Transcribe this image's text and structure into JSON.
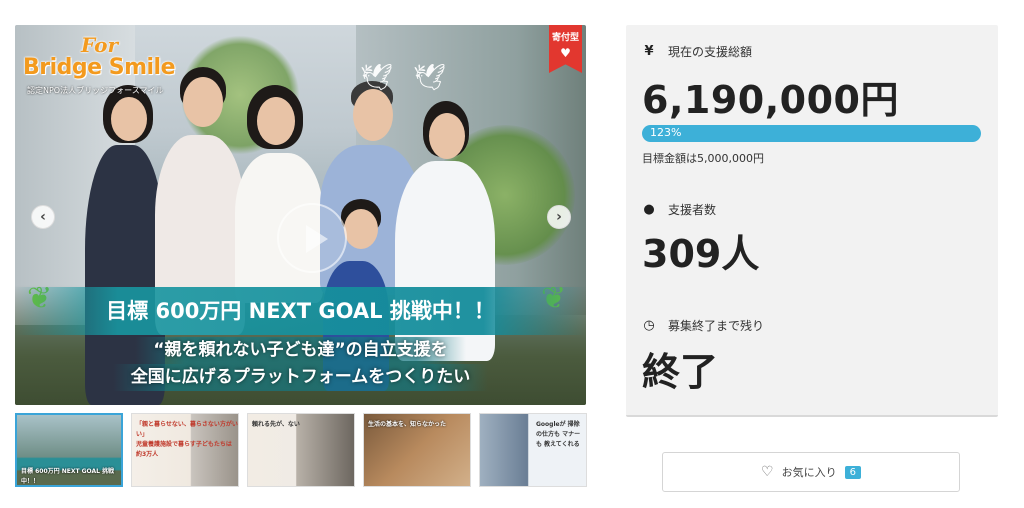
{
  "hero": {
    "logo_for": "For",
    "logo_main": "Bridge Smile",
    "logo_sub": "認定NPO法人ブリッジフォースマイル",
    "badge": "寄付型",
    "goal_banner": "目標 600万円 NEXT GOAL 挑戦中！！",
    "tagline_1": "“親を頼れない子ども達”の自立支援を",
    "tagline_2": "全国に広げるプラットフォームをつくりたい"
  },
  "thumbnails": [
    {
      "caption": "目標 600万円 NEXT GOAL 挑戦中！！",
      "active": true
    },
    {
      "caption": "「親と暮らせない、暮らさない方がいい」\n児童養護施設で暮らす子どもたちは\n約3万人",
      "active": false
    },
    {
      "caption": "頼れる先が、ない",
      "active": false
    },
    {
      "caption": "生活の基本を、知らなかった",
      "active": false
    },
    {
      "caption": "Googleが 掃除の仕方も マナーも 教えてくれる",
      "active": false
    }
  ],
  "stats": {
    "total_label": "現在の支援総額",
    "total_value": "6,190,000円",
    "progress_text": "123%",
    "progress_percent": 123,
    "target_text": "目標金額は5,000,000円",
    "supporters_label": "支援者数",
    "supporters_value": "309人",
    "remaining_label": "募集終了まで残り",
    "remaining_value": "終了"
  },
  "favorite": {
    "label": "お気に入り",
    "count": "6"
  },
  "icons": {
    "currency": "yen-icon",
    "person": "person-icon",
    "clock": "clock-icon",
    "heart": "heart-icon"
  },
  "colors": {
    "accent": "#3db0d8",
    "badge_red": "#e2372f",
    "logo_orange": "#f39a1e"
  }
}
